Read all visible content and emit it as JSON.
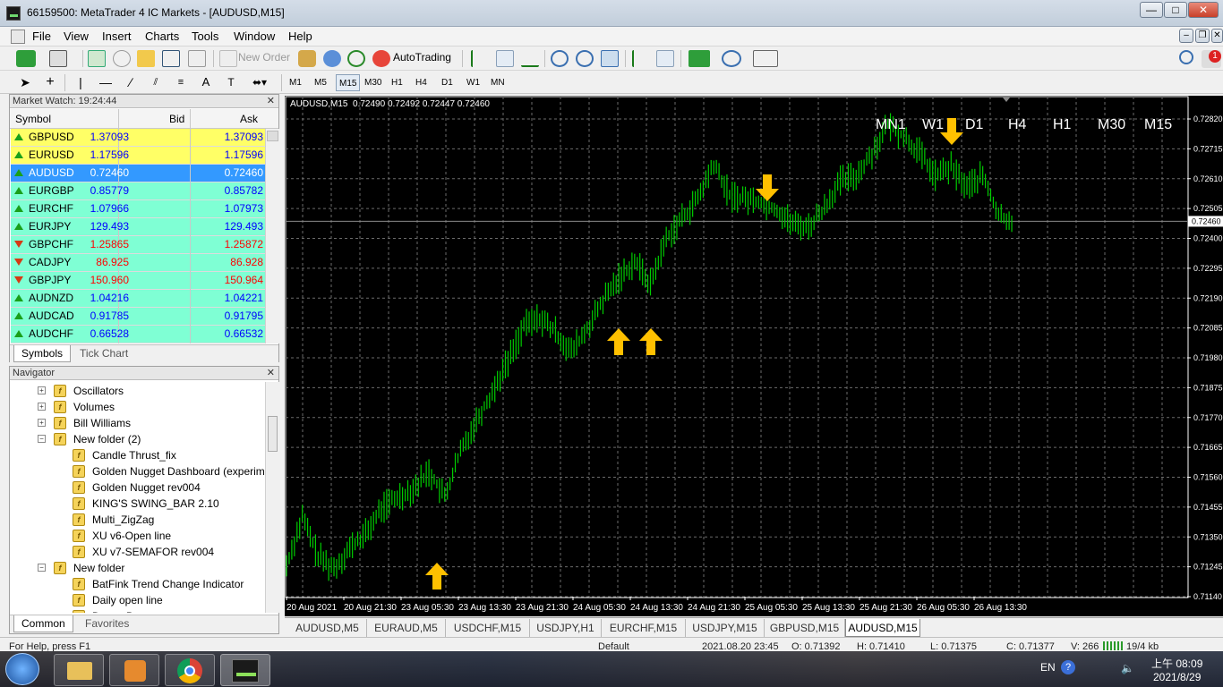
{
  "window": {
    "title": "66159500: MetaTrader 4 IC Markets - [AUDUSD,M15]",
    "minimize": "—",
    "maximize": "□",
    "close": "✕"
  },
  "menu": [
    "File",
    "View",
    "Insert",
    "Charts",
    "Tools",
    "Window",
    "Help"
  ],
  "toolbar": {
    "new_order": "New Order",
    "autotrading": "AutoTrading"
  },
  "timeframes": [
    "M1",
    "M5",
    "M15",
    "M30",
    "H1",
    "H4",
    "D1",
    "W1",
    "MN"
  ],
  "selected_timeframe": "M15",
  "market_watch": {
    "header": "Market Watch: 19:24:44",
    "col_symbol": "Symbol",
    "col_bid": "Bid",
    "col_ask": "Ask",
    "rows": [
      {
        "symbol": "GBPUSD",
        "bid": "1.37093",
        "ask": "1.37093",
        "dir": "up",
        "bg": "#ffff66",
        "color": "#0000ff"
      },
      {
        "symbol": "EURUSD",
        "bid": "1.17596",
        "ask": "1.17596",
        "dir": "up",
        "bg": "#ffff66",
        "color": "#0000ff"
      },
      {
        "symbol": "AUDUSD",
        "bid": "0.72460",
        "ask": "0.72460",
        "dir": "up",
        "bg": "#3399ff",
        "color": "#ffffff"
      },
      {
        "symbol": "EURGBP",
        "bid": "0.85779",
        "ask": "0.85782",
        "dir": "up",
        "bg": "#7fffd4",
        "color": "#0000ff"
      },
      {
        "symbol": "EURCHF",
        "bid": "1.07966",
        "ask": "1.07973",
        "dir": "up",
        "bg": "#7fffd4",
        "color": "#0000ff"
      },
      {
        "symbol": "EURJPY",
        "bid": "129.493",
        "ask": "129.493",
        "dir": "up",
        "bg": "#7fffd4",
        "color": "#0000ff"
      },
      {
        "symbol": "GBPCHF",
        "bid": "1.25865",
        "ask": "1.25872",
        "dir": "down",
        "bg": "#7fffd4",
        "color": "#ff0000"
      },
      {
        "symbol": "CADJPY",
        "bid": "86.925",
        "ask": "86.928",
        "dir": "down",
        "bg": "#7fffd4",
        "color": "#ff0000"
      },
      {
        "symbol": "GBPJPY",
        "bid": "150.960",
        "ask": "150.964",
        "dir": "down",
        "bg": "#7fffd4",
        "color": "#ff0000"
      },
      {
        "symbol": "AUDNZD",
        "bid": "1.04216",
        "ask": "1.04221",
        "dir": "up",
        "bg": "#7fffd4",
        "color": "#0000ff"
      },
      {
        "symbol": "AUDCAD",
        "bid": "0.91785",
        "ask": "0.91795",
        "dir": "up",
        "bg": "#7fffd4",
        "color": "#0000ff"
      },
      {
        "symbol": "AUDCHF",
        "bid": "0.66528",
        "ask": "0.66532",
        "dir": "up",
        "bg": "#7fffd4",
        "color": "#0000ff"
      }
    ],
    "tabs": [
      "Symbols",
      "Tick Chart"
    ]
  },
  "navigator": {
    "header": "Navigator",
    "items": [
      {
        "label": "Oscillators",
        "level": 1
      },
      {
        "label": "Volumes",
        "level": 1
      },
      {
        "label": "Bill Williams",
        "level": 1
      },
      {
        "label": "New folder (2)",
        "level": 1
      },
      {
        "label": "Candle Thrust_fix",
        "level": 2
      },
      {
        "label": "Golden Nugget Dashboard (experime",
        "level": 2
      },
      {
        "label": "Golden Nugget rev004",
        "level": 2
      },
      {
        "label": "KING'S SWING_BAR 2.10",
        "level": 2
      },
      {
        "label": "Multi_ZigZag",
        "level": 2
      },
      {
        "label": "XU v6-Open line",
        "level": 2
      },
      {
        "label": "XU v7-SEMAFOR rev004",
        "level": 2
      },
      {
        "label": "New folder",
        "level": 1
      },
      {
        "label": "BatFink Trend Change Indicator",
        "level": 2
      },
      {
        "label": "Daily open line",
        "level": 2
      },
      {
        "label": "Donev Bars area",
        "level": 2
      }
    ],
    "tabs": [
      "Common",
      "Favorites"
    ]
  },
  "chart": {
    "info": "AUDUSD,M15  0.72490 0.72492 0.72447 0.72460",
    "tf_labels": [
      "MN1",
      "W1",
      "D1",
      "H4",
      "H1",
      "M30",
      "M15"
    ],
    "price_labels": [
      "0.72820",
      "0.72715",
      "0.72610",
      "0.72505",
      "0.72400",
      "0.72295",
      "0.72190",
      "0.72085",
      "0.71980",
      "0.71875",
      "0.71770",
      "0.71665",
      "0.71560",
      "0.71455",
      "0.71350",
      "0.71245",
      "0.71140"
    ],
    "current_price": "0.72460",
    "time_labels": [
      "20 Aug 2021",
      "20 Aug 21:30",
      "23 Aug 05:30",
      "23 Aug 13:30",
      "23 Aug 21:30",
      "24 Aug 05:30",
      "24 Aug 13:30",
      "24 Aug 21:30",
      "25 Aug 05:30",
      "25 Aug 13:30",
      "25 Aug 21:30",
      "26 Aug 05:30",
      "26 Aug 13:30"
    ],
    "line_color": "#00cc00",
    "arrow_color": "#ffc000"
  },
  "chart_data": {
    "type": "line",
    "title": "AUDUSD,M15",
    "series": [
      {
        "values": [
          0.7125,
          0.7142,
          0.7128,
          0.7124,
          0.7131,
          0.7136,
          0.7145,
          0.7149,
          0.7152,
          0.7158,
          0.7149,
          0.7165,
          0.7176,
          0.7186,
          0.7197,
          0.7209,
          0.7212,
          0.7207,
          0.72,
          0.7208,
          0.7218,
          0.7226,
          0.7232,
          0.7224,
          0.724,
          0.7247,
          0.7254,
          0.7266,
          0.7255,
          0.7254,
          0.7253,
          0.725,
          0.7245,
          0.7244,
          0.7251,
          0.726,
          0.7262,
          0.727,
          0.728,
          0.7276,
          0.727,
          0.7262,
          0.7265,
          0.7258,
          0.7262,
          0.7248,
          0.7246
        ]
      }
    ],
    "ylim": [
      0.7114,
      0.7282
    ],
    "grid": true
  },
  "bottom_tabs": [
    "AUDUSD,M5",
    "EURAUD,M5",
    "USDCHF,M15",
    "USDJPY,H1",
    "EURCHF,M15",
    "USDJPY,M15",
    "GBPUSD,M15",
    "AUDUSD,M15"
  ],
  "active_tab": "AUDUSD,M15",
  "status": {
    "help": "For Help, press F1",
    "profile": "Default",
    "time": "2021.08.20 23:45",
    "open": "O: 0.71392",
    "high": "H: 0.71410",
    "low": "L: 0.71375",
    "close": "C: 0.71377",
    "volume": "V: 266",
    "conn": "19/4 kb"
  },
  "taskbar": {
    "lang": "EN",
    "time": "上午 08:09",
    "date": "2021/8/29",
    "notif_badge": "1"
  }
}
